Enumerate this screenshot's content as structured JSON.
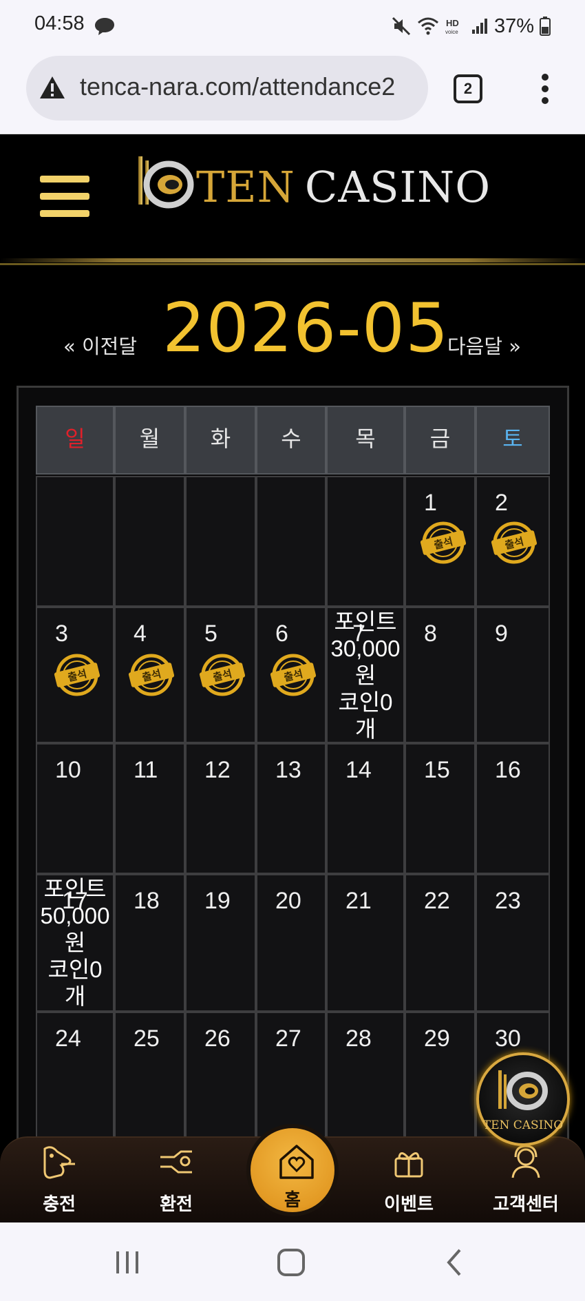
{
  "status_bar": {
    "time": "04:58",
    "battery_pct": "37%",
    "icons": [
      "messenger-icon",
      "mute-icon",
      "wifi-icon",
      "hd-voice-icon",
      "signal-icon",
      "battery-icon"
    ]
  },
  "browser": {
    "url": "tenca-nara.com/attendance2",
    "tab_count": "2",
    "icons": [
      "not-secure-icon",
      "tabs-icon",
      "more-icon"
    ]
  },
  "header": {
    "logo_ten": "TEN",
    "logo_casino": "CASINO",
    "accent_gold": "#d6a638"
  },
  "calendar": {
    "prev_label": "« 이전달",
    "next_label": "다음달 »",
    "month": "2026-05",
    "month_color": "#f2c230",
    "weekdays": [
      "일",
      "월",
      "화",
      "수",
      "목",
      "금",
      "토"
    ],
    "sunday_color": "#e0202a",
    "saturday_color": "#5ab4f0",
    "days": {
      "d1": "1",
      "d2": "2",
      "d3": "3",
      "d4": "4",
      "d5": "5",
      "d6": "6",
      "d7": "7",
      "d8": "8",
      "d9": "9",
      "d10": "10",
      "d11": "11",
      "d12": "12",
      "d13": "13",
      "d14": "14",
      "d15": "15",
      "d16": "16",
      "d17": "17",
      "d18": "18",
      "d19": "19",
      "d20": "20",
      "d21": "21",
      "d22": "22",
      "d23": "23",
      "d24": "24",
      "d25": "25",
      "d26": "26",
      "d27": "27",
      "d28": "28",
      "d29": "29",
      "d30": "30"
    },
    "stamp_label": "출석",
    "attended_days": [
      1,
      2,
      3,
      4,
      5,
      6
    ],
    "reward_7": [
      "포인트",
      "30,000",
      "원",
      "코인0",
      "개"
    ],
    "reward_17": [
      "포인트",
      "50,000",
      "원",
      "코인0",
      "개"
    ]
  },
  "badge": {
    "text": "TEN CASINO"
  },
  "bottom_nav": {
    "charge": "충전",
    "exchange": "환전",
    "home": "홈",
    "event": "이벤트",
    "support": "고객센터"
  }
}
